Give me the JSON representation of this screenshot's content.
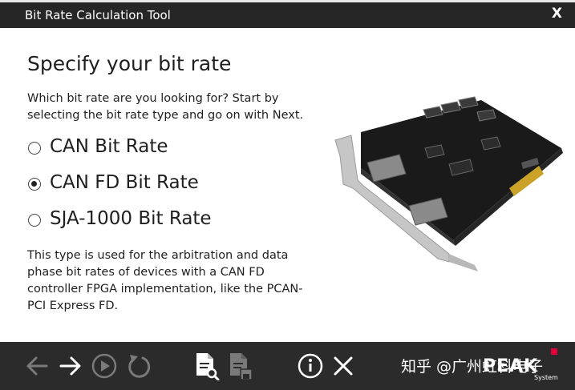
{
  "window": {
    "title": "Bit Rate Calculation Tool",
    "close_label": "X"
  },
  "page": {
    "heading": "Specify your bit rate",
    "intro": "Which bit rate are you looking for? Start by selecting the bit rate type and go on with Next.",
    "options": [
      {
        "label": "CAN Bit Rate",
        "selected": false
      },
      {
        "label": "CAN FD Bit Rate",
        "selected": true
      },
      {
        "label": "SJA-1000 Bit Rate",
        "selected": false
      }
    ],
    "description": "This type is used for the arbitration and data phase bit rates of devices with a CAN FD controller FPGA implementation, like the PCAN-PCI Express FD."
  },
  "toolbar": {
    "watermark": "知乎 @广州虹科电子",
    "logo_text": "PEAK",
    "logo_subtext": "System",
    "accent_color": "#e2003a"
  },
  "colors": {
    "titlebar_bg": "#262626",
    "toolbar_bg": "#2b2b2b",
    "icon_enabled": "#ffffff",
    "icon_disabled": "#7a7a7a"
  }
}
